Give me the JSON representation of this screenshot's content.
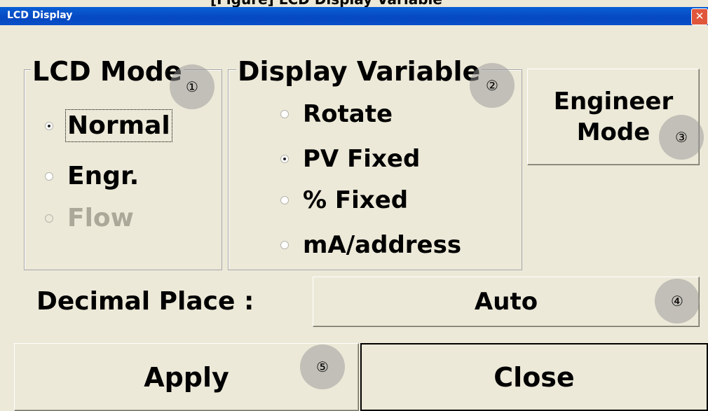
{
  "caption": "[Figure] LCD Display Variable",
  "window": {
    "title": "LCD Display",
    "close_glyph": "✕"
  },
  "lcd_mode": {
    "title": "LCD Mode",
    "options": [
      {
        "label": "Normal",
        "selected": true,
        "enabled": true
      },
      {
        "label": "Engr.",
        "selected": false,
        "enabled": true
      },
      {
        "label": "Flow",
        "selected": false,
        "enabled": false
      }
    ]
  },
  "display_variable": {
    "title": "Display Variable",
    "options": [
      {
        "label": "Rotate",
        "selected": false
      },
      {
        "label": "PV Fixed",
        "selected": true
      },
      {
        "label": "% Fixed",
        "selected": false
      },
      {
        "label": "mA/address",
        "selected": false
      }
    ]
  },
  "engineer_mode": {
    "line1": "Engineer",
    "line2": "Mode"
  },
  "decimal_place": {
    "label": "Decimal Place :",
    "value": "Auto"
  },
  "buttons": {
    "apply": "Apply",
    "close": "Close"
  },
  "markers": [
    "①",
    "②",
    "③",
    "④",
    "⑤"
  ],
  "colors": {
    "dialog_bg": "#ECE9D8",
    "titlebar": "#0548C0",
    "close_button": "#E0563B",
    "disabled_text": "#ACA899"
  }
}
